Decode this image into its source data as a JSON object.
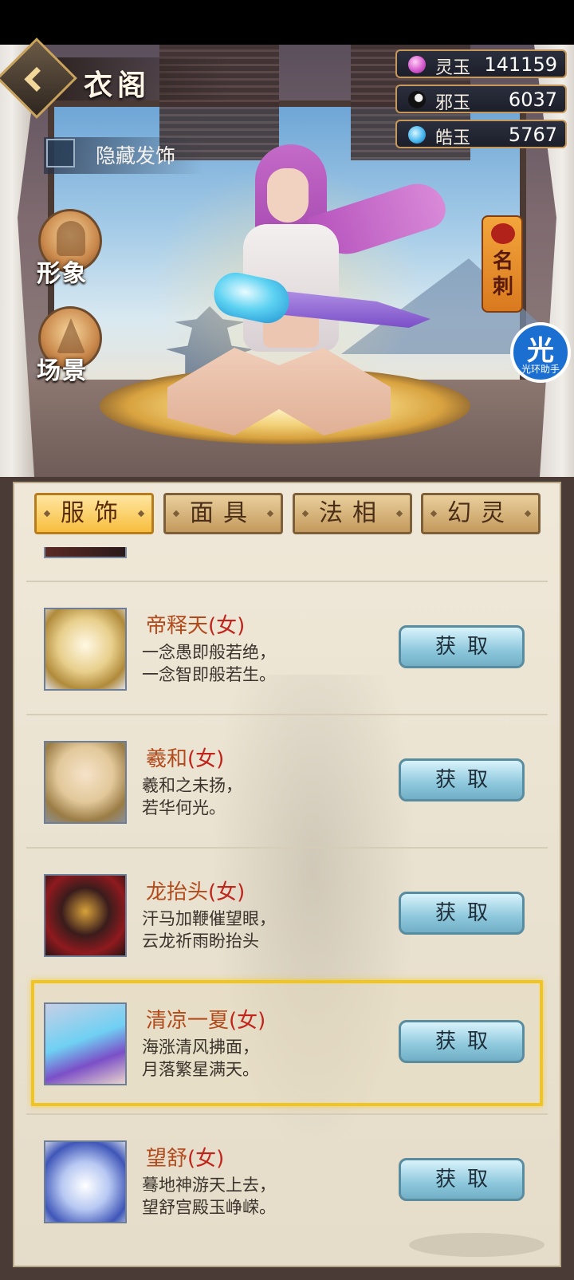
{
  "header": {
    "title": "衣阁",
    "hide_hair": "隐藏发饰"
  },
  "currencies": [
    {
      "name": "灵玉",
      "value": "141159",
      "color": "#d85bd0"
    },
    {
      "name": "邪玉",
      "value": "6037",
      "color": "#222222"
    },
    {
      "name": "皓玉",
      "value": "5767",
      "color": "#49b8f0"
    }
  ],
  "side_buttons": {
    "appearance": "形象",
    "scene": "场景"
  },
  "card_tag": "名刺",
  "assistant": {
    "icon": "光",
    "label": "光环助手"
  },
  "tabs": [
    {
      "label": "服饰",
      "active": true
    },
    {
      "label": "面具",
      "active": false
    },
    {
      "label": "法相",
      "active": false
    },
    {
      "label": "幻灵",
      "active": false
    }
  ],
  "items": [
    {
      "name": "帝释天",
      "gender": "(女)",
      "line1": "一念愚即般若绝，",
      "line2": "一念智即般若生。",
      "button": "获取",
      "selected": false
    },
    {
      "name": "羲和",
      "gender": "(女)",
      "line1": "羲和之未扬，",
      "line2": "若华何光。",
      "button": "获取",
      "selected": false
    },
    {
      "name": "龙抬头",
      "gender": "(女)",
      "line1": "汗马加鞭催望眼，",
      "line2": "云龙祈雨盼抬头",
      "button": "获取",
      "selected": false
    },
    {
      "name": "清凉一夏",
      "gender": "(女)",
      "line1": "海涨清风拂面，",
      "line2": "月落繁星满天。",
      "button": "获取",
      "selected": true
    },
    {
      "name": "望舒",
      "gender": "(女)",
      "line1": "蓦地神游天上去，",
      "line2": "望舒宫殿玉峥嵘。",
      "button": "获取",
      "selected": false
    }
  ],
  "icons": {
    "back": "back-chevron-icon",
    "appearance": "character-portrait-icon",
    "scene": "mountain-scene-icon",
    "card": "red-swirl-icon"
  },
  "accent": "#f2c51e"
}
